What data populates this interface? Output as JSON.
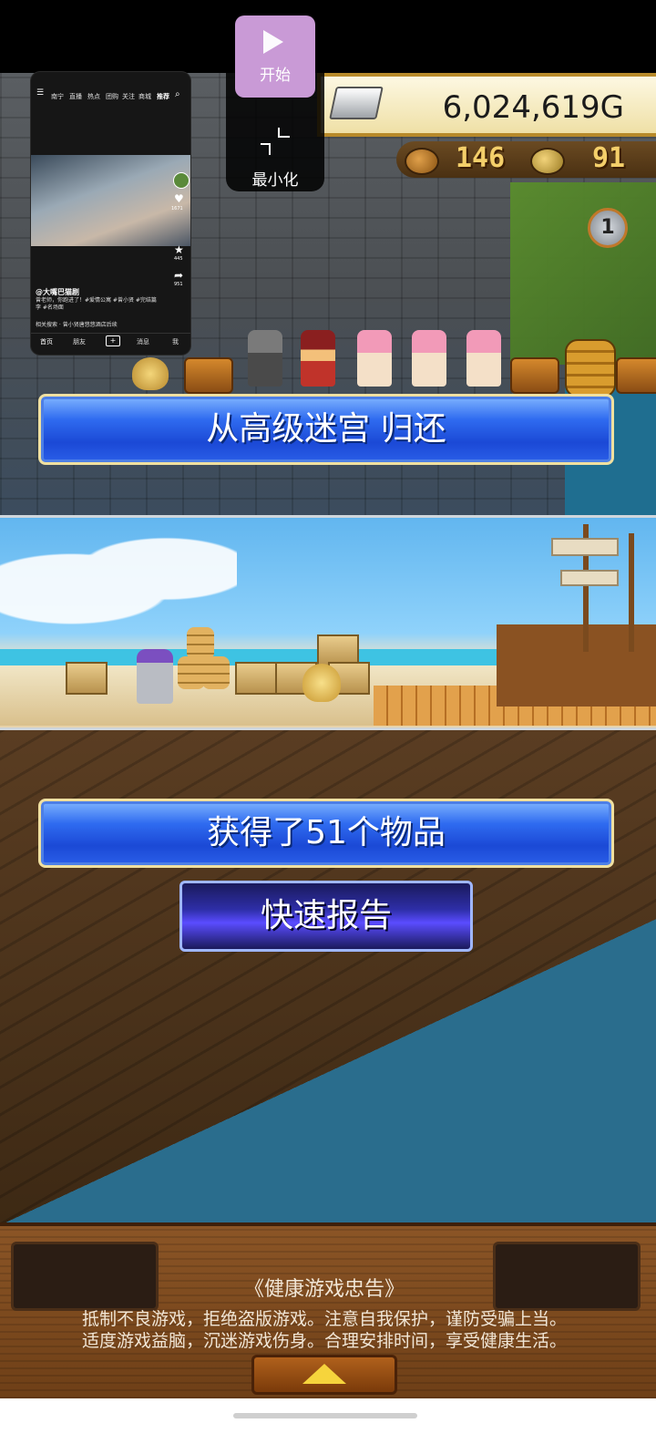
{
  "game": {
    "gold": "6,024,619G",
    "resource_a": "146",
    "resource_b": "91",
    "round_badge": "1",
    "return_banner": "从高级迷宫 归还",
    "items_banner": "获得了51个物品",
    "quick_report": "快速报告"
  },
  "advisory": {
    "title": "《健康游戏忠告》",
    "line1": "抵制不良游戏，拒绝盗版游戏。注意自我保护，谨防受骗上当。",
    "line2": "适度游戏益脑，沉迷游戏伤身。合理安排时间，享受健康生活。"
  },
  "overlay": {
    "start_label": "开始",
    "minimize_label": "最小化"
  },
  "floating_window": {
    "tabs": [
      "南宁",
      "直播",
      "热点",
      "团购",
      "关注",
      "商城",
      "推荐"
    ],
    "author": "@大嘴巴猫剧",
    "caption": "曾老师，你跑进了！#爱情公寓 #曾小贤 #完结篇 李 #名场面",
    "search": "相关搜索 · 曾小贤唐悠悠酒店后续",
    "nav": [
      "首页",
      "朋友",
      "+",
      "消息",
      "我"
    ],
    "counts": [
      "1671",
      "445",
      "951"
    ]
  },
  "colors": {
    "banner_blue": "#2f6bf0",
    "report_navy": "#2e2ea8",
    "gold_text": "#f4cf6a",
    "start_purple": "#c99ad6"
  }
}
